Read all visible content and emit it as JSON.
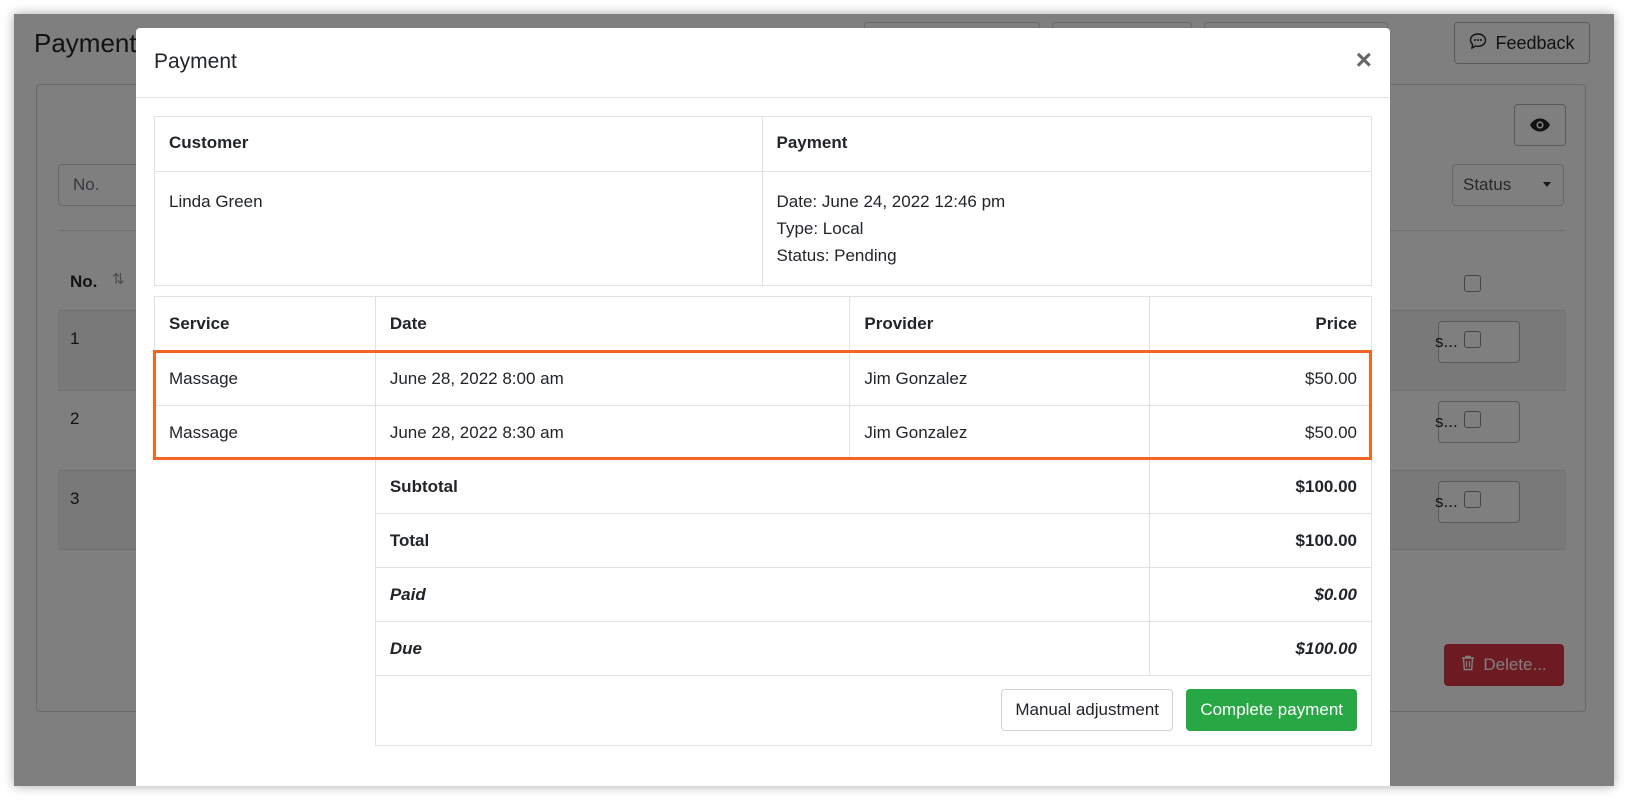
{
  "background": {
    "page_title": "Payment",
    "feedback_label": "Feedback",
    "filter_no_placeholder": "No.",
    "filter_status": "Status",
    "col_no": "No.",
    "rows": [
      "1",
      "2",
      "3"
    ],
    "row_action_label": "s...",
    "delete_label": "Delete..."
  },
  "modal": {
    "title": "Payment",
    "close_glyph": "×",
    "info": {
      "customer_header": "Customer",
      "payment_header": "Payment",
      "customer_name": "Linda Green",
      "payment_date": "Date: June 24, 2022 12:46 pm",
      "payment_type": "Type: Local",
      "payment_status": "Status: Pending"
    },
    "items": {
      "headers": {
        "service": "Service",
        "date": "Date",
        "provider": "Provider",
        "price": "Price"
      },
      "rows": [
        {
          "service": "Massage",
          "date": "June 28, 2022 8:00 am",
          "provider": "Jim Gonzalez",
          "price": "$50.00"
        },
        {
          "service": "Massage",
          "date": "June 28, 2022 8:30 am",
          "provider": "Jim Gonzalez",
          "price": "$50.00"
        }
      ],
      "subtotal_label": "Subtotal",
      "subtotal_value": "$100.00",
      "total_label": "Total",
      "total_value": "$100.00",
      "paid_label": "Paid",
      "paid_value": "$0.00",
      "due_label": "Due",
      "due_value": "$100.00"
    },
    "buttons": {
      "manual_adjustment": "Manual adjustment",
      "complete_payment": "Complete payment"
    }
  },
  "colors": {
    "highlight": "#f26522",
    "success": "#28a745",
    "danger": "#dc3545"
  }
}
